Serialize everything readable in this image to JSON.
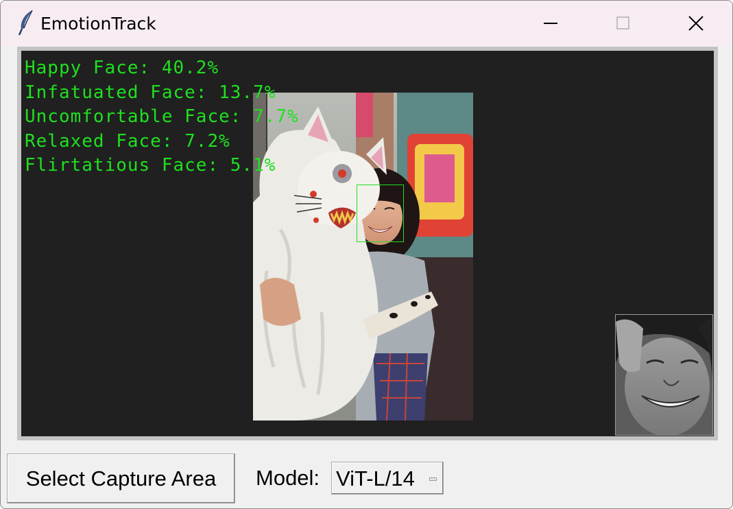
{
  "window": {
    "title": "EmotionTrack",
    "icon": "feather-icon",
    "controls": [
      "minimize-icon",
      "maximize-icon",
      "close-icon"
    ]
  },
  "overlay": {
    "color": "#1ee01e",
    "emotions": [
      {
        "text": "Happy Face: 40.2%",
        "label": "Happy Face",
        "percent": 40.2
      },
      {
        "text": "Infatuated Face: 13.7%",
        "label": "Infatuated Face",
        "percent": 13.7
      },
      {
        "text": "Uncomfortable Face: 7.7%",
        "label": "Uncomfortable Face",
        "percent": 7.7
      },
      {
        "text": "Relaxed Face: 7.2%",
        "label": "Relaxed Face",
        "percent": 7.2
      },
      {
        "text": "Flirtatious Face: 5.1%",
        "label": "Flirtatious Face",
        "percent": 5.1
      }
    ]
  },
  "controls": {
    "capture_button_label": "Select Capture Area",
    "model_label": "Model:",
    "model_selected": "ViT-L/14"
  }
}
